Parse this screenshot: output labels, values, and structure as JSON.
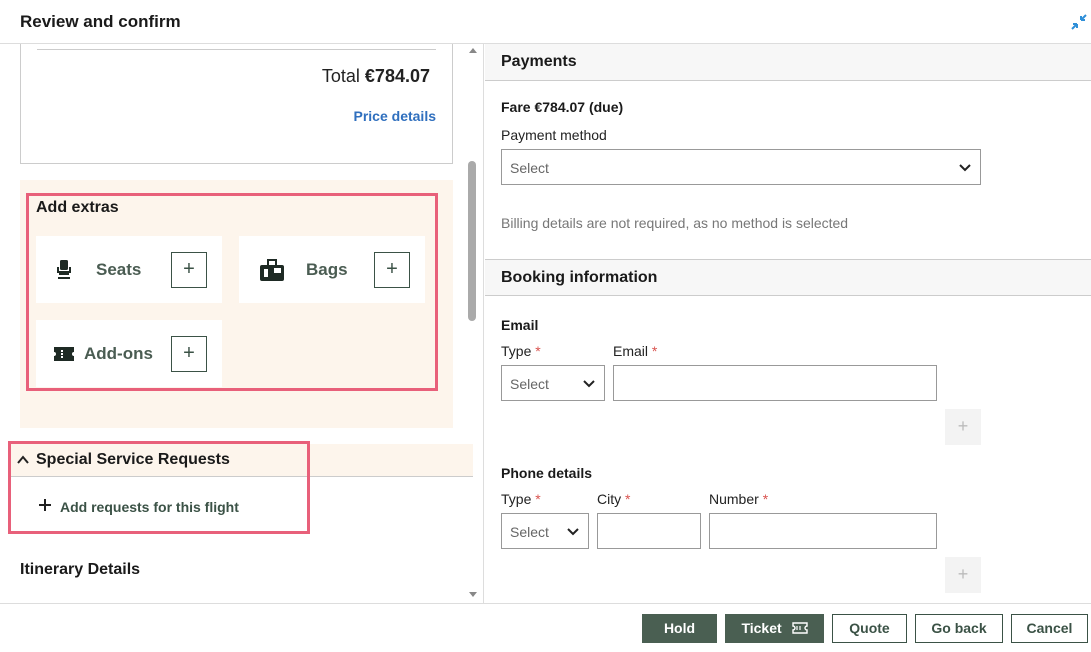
{
  "header": {
    "title": "Review and confirm",
    "collapse_icon": "collapse-icon"
  },
  "price": {
    "total_label": "Total",
    "total_value": "€784.07",
    "details_link": "Price details"
  },
  "extras": {
    "title": "Add extras",
    "items": [
      {
        "label": "Seats",
        "icon": "seat-icon"
      },
      {
        "label": "Bags",
        "icon": "bags-icon"
      },
      {
        "label": "Add-ons",
        "icon": "ticket-icon"
      }
    ]
  },
  "ssr": {
    "title": "Special Service Requests",
    "add_label": "Add requests for this flight"
  },
  "itinerary": {
    "title": "Itinerary Details"
  },
  "payments": {
    "title": "Payments",
    "fare": "Fare €784.07 (due)",
    "method_label": "Payment method",
    "method_value": "Select",
    "billing_note": "Billing details are not required, as no method is selected"
  },
  "booking": {
    "title": "Booking information",
    "email": {
      "section_label": "Email",
      "type_label": "Type",
      "type_value": "Select",
      "email_label": "Email",
      "email_value": ""
    },
    "phone": {
      "section_label": "Phone details",
      "type_label": "Type",
      "type_value": "Select",
      "city_label": "City",
      "city_value": "",
      "number_label": "Number",
      "number_value": ""
    },
    "required_mark": "*",
    "add_symbol": "+"
  },
  "footer": {
    "hold": "Hold",
    "ticket": "Ticket",
    "quote": "Quote",
    "go_back": "Go back",
    "cancel": "Cancel"
  },
  "colors": {
    "primary": "#4a5f52",
    "link": "#2f6fbe",
    "highlight": "#e8607a",
    "extras_bg": "#fdf5ec",
    "required": "#d9534f"
  }
}
